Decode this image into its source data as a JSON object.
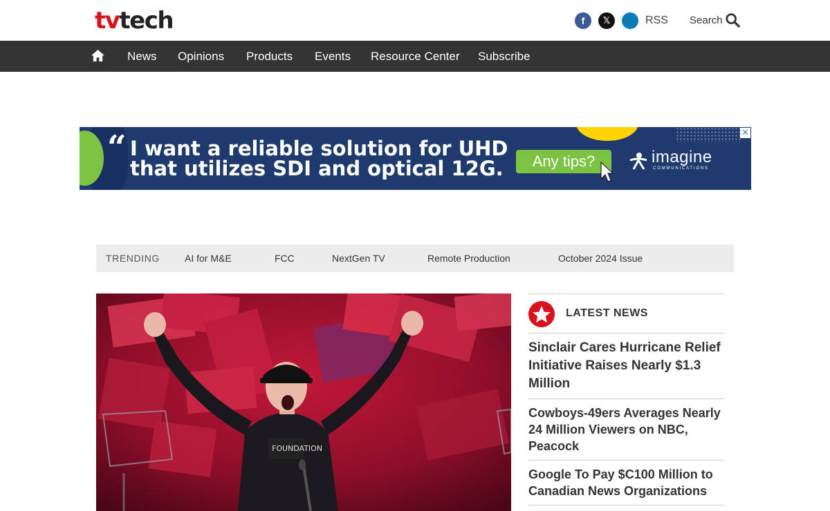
{
  "header": {
    "logo_tv": "tv",
    "logo_tech": "tech",
    "social": {
      "facebook": "f",
      "x": "𝕏",
      "linkedin": ""
    },
    "rss_label": "RSS",
    "search_label": "Search"
  },
  "nav": {
    "items": [
      "News",
      "Opinions",
      "Products",
      "Events",
      "Resource Center",
      "Subscribe"
    ]
  },
  "ad": {
    "line1": "I want a reliable solution for UHD",
    "line2": "that utilizes SDI and optical 12G.",
    "button": "Any tips?",
    "brand": "imagine",
    "brand_sub": "COMMUNICATIONS",
    "close": "✕"
  },
  "trending": {
    "label": "TRENDING",
    "items": [
      "AI for M&E",
      "FCC",
      "NextGen TV",
      "Remote Production",
      "October 2024 Issue"
    ]
  },
  "latest_news": {
    "title": "LATEST NEWS",
    "items": [
      "Sinclair Cares Hurricane Relief Initiative Raises Nearly $1.3 Million",
      "Cowboys-49ers Averages Nearly 24 Million Viewers on NBC, Peacock",
      "Google To Pay $C100 Million to Canadian News Organizations"
    ]
  },
  "colors": {
    "brand_red": "#d7141e",
    "nav_bg": "#333333",
    "ad_navy": "#1f3a6e",
    "ad_green": "#7cc243"
  }
}
